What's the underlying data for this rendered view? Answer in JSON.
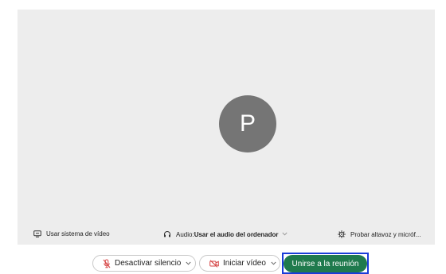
{
  "preview": {
    "avatar_initial": "P"
  },
  "options": {
    "video_system": "Usar sistema de vídeo",
    "audio_prefix": "Audio: ",
    "audio_value": "Usar el audio del ordenador",
    "speaker_test": "Probar altavoz y micróf..."
  },
  "controls": {
    "mute_label": "Desactivar silencio",
    "video_label": "Iniciar vídeo",
    "join_label": "Unirse a la reunión"
  },
  "colors": {
    "join_button": "#1f7a4d",
    "focus_ring": "#1a3cd8",
    "muted_icon": "#d64545",
    "avatar_bg": "#757575"
  },
  "icons": {
    "video_system": "screen-icon",
    "audio": "headset-icon",
    "speaker_test": "gear-icon",
    "mute": "mic-muted-icon",
    "video": "camera-off-icon"
  }
}
